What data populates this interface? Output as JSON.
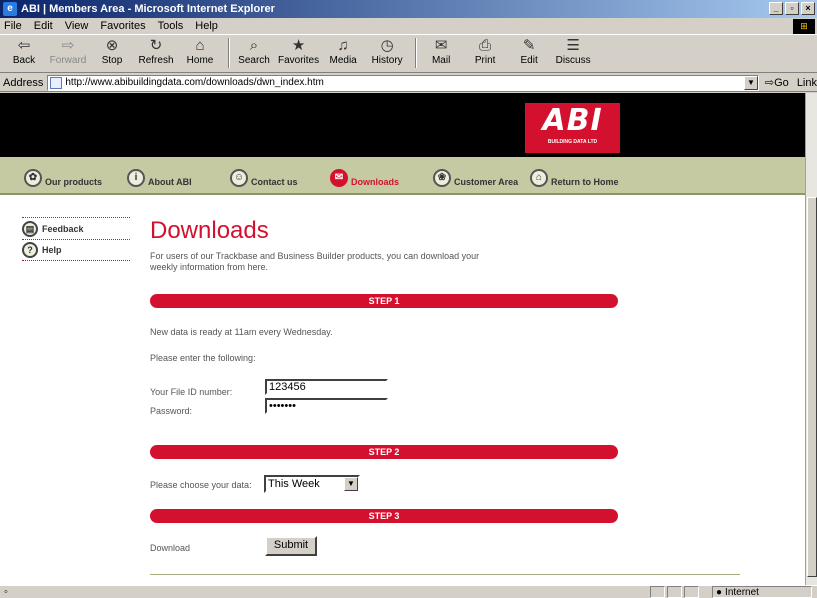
{
  "window": {
    "title": "ABI | Members Area - Microsoft Internet Explorer",
    "controls": [
      "_",
      "▫",
      "×"
    ]
  },
  "menu": [
    "File",
    "Edit",
    "View",
    "Favorites",
    "Tools",
    "Help"
  ],
  "toolbar": [
    {
      "label": "Back",
      "icon": "back-arrow-icon",
      "glyph": "⇦"
    },
    {
      "label": "Forward",
      "icon": "forward-arrow-icon",
      "glyph": "⇨"
    },
    {
      "label": "Stop",
      "icon": "stop-icon",
      "glyph": "⊗"
    },
    {
      "label": "Refresh",
      "icon": "refresh-icon",
      "glyph": "↻"
    },
    {
      "label": "Home",
      "icon": "home-icon",
      "glyph": "⌂"
    },
    {
      "label": "Search",
      "icon": "search-icon",
      "glyph": "⌕"
    },
    {
      "label": "Favorites",
      "icon": "favorites-icon",
      "glyph": "★"
    },
    {
      "label": "Media",
      "icon": "media-icon",
      "glyph": "♫"
    },
    {
      "label": "History",
      "icon": "history-icon",
      "glyph": "◷"
    },
    {
      "label": "Mail",
      "icon": "mail-icon",
      "glyph": "✉"
    },
    {
      "label": "Print",
      "icon": "print-icon",
      "glyph": "⎙"
    },
    {
      "label": "Edit",
      "icon": "edit-icon",
      "glyph": "✎"
    },
    {
      "label": "Discuss",
      "icon": "discuss-icon",
      "glyph": "☰"
    }
  ],
  "address": {
    "label": "Address",
    "url": "http://www.abibuildingdata.com/downloads/dwn_index.htm",
    "go": "Go",
    "links": "Link"
  },
  "site": {
    "logo_text": "ABI",
    "logo_sub": "BUILDING DATA LTD",
    "nav": [
      {
        "label": "Our products",
        "icon": "products-icon",
        "glyph": "✿",
        "active": false
      },
      {
        "label": "About ABI",
        "icon": "info-icon",
        "glyph": "i",
        "active": false
      },
      {
        "label": "Contact us",
        "icon": "contact-icon",
        "glyph": "☺",
        "active": false
      },
      {
        "label": "Downloads",
        "icon": "downloads-icon",
        "glyph": "✉",
        "active": true
      },
      {
        "label": "Customer Area",
        "icon": "customer-icon",
        "glyph": "❀",
        "active": false
      },
      {
        "label": "Return to Home",
        "icon": "home-icon",
        "glyph": "⌂",
        "active": false
      }
    ],
    "sidebar": [
      {
        "label": "Feedback",
        "icon": "feedback-icon",
        "glyph": "▤"
      },
      {
        "label": "Help",
        "icon": "help-icon",
        "glyph": "?"
      }
    ]
  },
  "main": {
    "title": "Downloads",
    "intro": "For users of our Trackbase and Business Builder products, you can download your weekly information from here.",
    "step1": "STEP 1",
    "ready_text": "New data is ready at 11am every Wednesday.",
    "enter_text": "Please enter the following:",
    "file_id_label": "Your File ID number:",
    "file_id_value": "123456",
    "password_label": "Password:",
    "password_value": "•••••••",
    "step2": "STEP 2",
    "choose_label": "Please choose your data:",
    "choose_value": "This Week",
    "step3": "STEP 3",
    "download_label": "Download",
    "submit_label": "Submit"
  },
  "status": {
    "zone": "Internet"
  }
}
